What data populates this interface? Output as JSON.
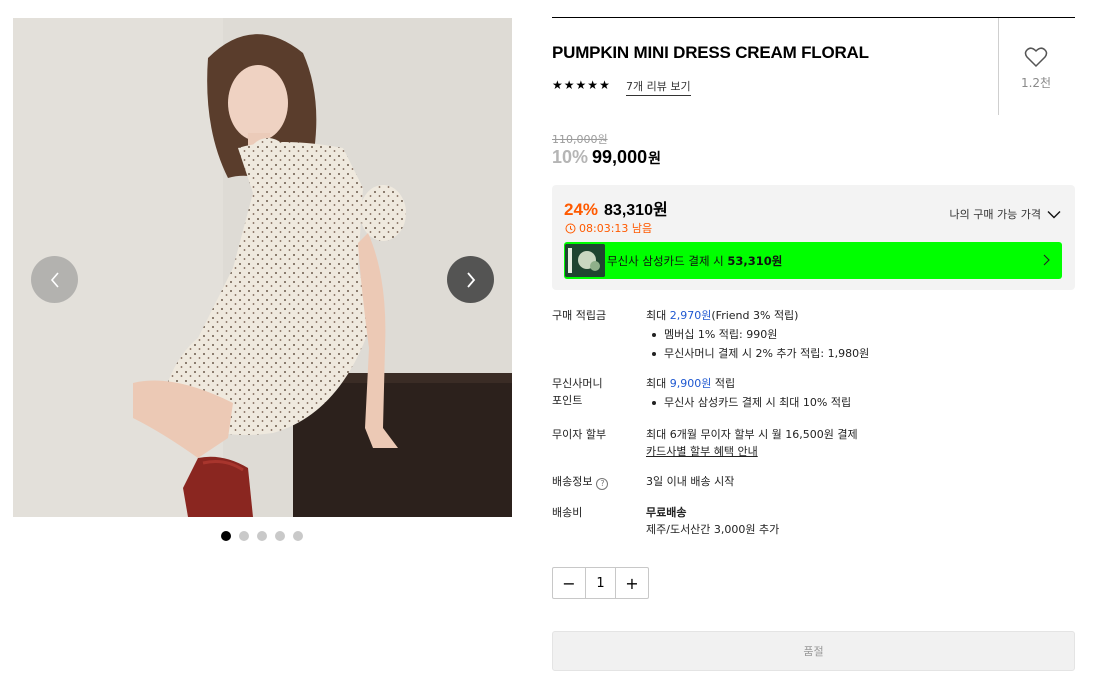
{
  "gallery": {
    "dots": [
      true,
      false,
      false,
      false,
      false
    ],
    "prev_icon": "chevron-left-icon",
    "next_icon": "chevron-right-icon"
  },
  "product": {
    "title": "PUMPKIN MINI DRESS CREAM FLORAL",
    "rating_stars": 5,
    "review_link": "7개 리뷰 보기",
    "wish_count": "1.2천",
    "original_price": "110,000원",
    "discount_rate": "10%",
    "sale_price": "99,000",
    "won": "원"
  },
  "benefit": {
    "best_rate": "24%",
    "best_price": "83,310원",
    "timer": "08:03:13 남음",
    "my_price_label": "나의 구매 가능 가격",
    "card_text_prefix": "무신사 삼성카드 결제 시",
    "card_price": "53,310원",
    "banner_color": "#00ff00",
    "accent_color": "#ff5a00"
  },
  "info": {
    "points": {
      "label": "구매 적립금",
      "prefix": "최대 ",
      "amount": "2,970원",
      "suffix": "(Friend 3% 적립)",
      "bullets": [
        "멤버십 1% 적립: 990원",
        "무신사머니 결제 시 2% 추가 적립: 1,980원"
      ]
    },
    "money": {
      "label_line1": "무신사머니",
      "label_line2": "포인트",
      "prefix": "최대 ",
      "amount": "9,900원",
      "suffix": " 적립",
      "bullets": [
        "무신사 삼성카드 결제 시 최대 10% 적립"
      ]
    },
    "installment": {
      "label": "무이자 할부",
      "line1": "최대 6개월 무이자 할부 시 월 16,500원 결제",
      "link": "카드사별 할부 혜택 안내"
    },
    "shipping_info": {
      "label": "배송정보",
      "value": "3일 이내 배송 시작"
    },
    "shipping_fee": {
      "label": "배송비",
      "value_bold": "무료배송",
      "value_sub": "제주/도서산간 3,000원 추가"
    }
  },
  "quantity": {
    "minus": "−",
    "value": "1",
    "plus": "+"
  },
  "buy_button": "품절"
}
